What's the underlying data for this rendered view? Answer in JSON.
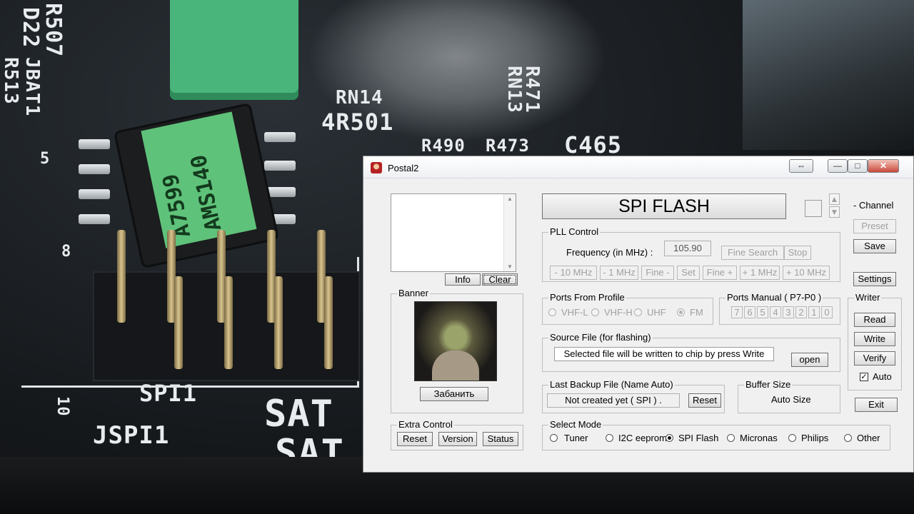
{
  "background": {
    "silk_texts": [
      "R507",
      "D22",
      "JBAT1",
      "R513",
      "RN14",
      "4R501",
      "R471",
      "RN13",
      "R490",
      "R473",
      "C465",
      "SPI1",
      "JSPI1",
      "SAT",
      "SAT",
      "10",
      "5",
      "8"
    ],
    "chip_label": [
      "A7599",
      "AMS140"
    ]
  },
  "window": {
    "title": "Postal2",
    "title_buttons": {
      "swap": "⇔",
      "minimize": "—",
      "maximize": "□",
      "close": "✕"
    }
  },
  "log_panel": {
    "info_label": "Info",
    "clear_label": "Clear"
  },
  "banner": {
    "title": "Banner",
    "ban_label": "Забанить"
  },
  "extra_control": {
    "title": "Extra Control",
    "reset_label": "Reset",
    "version_label": "Version",
    "status_label": "Status"
  },
  "chip_type_label": "SPI FLASH",
  "channel": {
    "label": "- Channel",
    "preset_label": "Preset",
    "save_label": "Save",
    "settings_label": "Settings"
  },
  "pll": {
    "title": "PLL Control",
    "freq_label": "Frequency (in MHz) :",
    "freq_value": "105.90",
    "fine_search_label": "Fine Search",
    "stop_label": "Stop",
    "step_buttons": [
      "- 10 MHz",
      "- 1 MHz",
      "Fine -",
      "Set",
      "Fine +",
      "+ 1 MHz",
      "+ 10 MHz"
    ]
  },
  "ports_profile": {
    "title": "Ports From Profile",
    "options": [
      "VHF-L",
      "VHF-H",
      "UHF",
      "FM"
    ],
    "selected": "FM"
  },
  "ports_manual": {
    "title": "Ports Manual ( P7-P0 )",
    "bits": [
      "7",
      "6",
      "5",
      "4",
      "3",
      "2",
      "1",
      "0"
    ]
  },
  "source_file": {
    "title": "Source File (for flashing)",
    "value": "Selected file will be written to chip by press Write",
    "open_label": "open"
  },
  "backup": {
    "title": "Last Backup File (Name Auto)",
    "value": "Not created yet ( SPI ) .",
    "reset_label": "Reset"
  },
  "buffer": {
    "title": "Buffer Size",
    "value": "Auto Size"
  },
  "writer": {
    "title": "Writer",
    "read_label": "Read",
    "write_label": "Write",
    "verify_label": "Verify",
    "auto_label": "Auto",
    "auto_checked": true
  },
  "exit_label": "Exit",
  "select_mode": {
    "title": "Select Mode",
    "options": [
      "Tuner",
      "I2C eeprom",
      "SPI Flash",
      "Micronas",
      "Philips",
      "Other"
    ],
    "selected": "SPI Flash"
  }
}
